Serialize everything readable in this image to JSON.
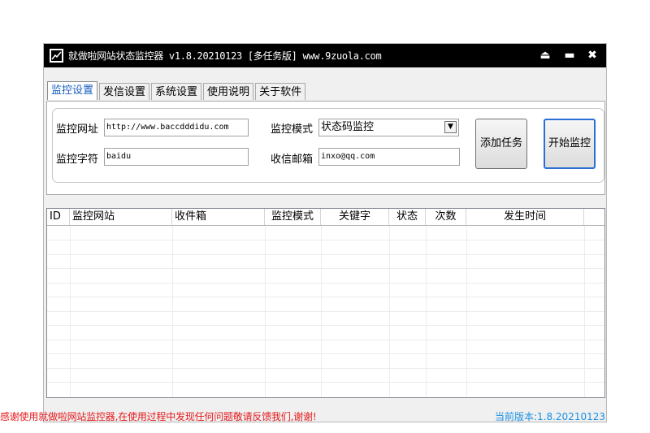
{
  "window": {
    "title": "就做啦网站状态监控器 v1.8.20210123 [多任务版] www.9zuola.com",
    "controls": {
      "pin": "⏏",
      "minimize": "▬",
      "close": "✖"
    }
  },
  "tabs": [
    {
      "label": "监控设置",
      "active": true
    },
    {
      "label": "发信设置",
      "active": false
    },
    {
      "label": "系统设置",
      "active": false
    },
    {
      "label": "使用说明",
      "active": false
    },
    {
      "label": "关于软件",
      "active": false
    }
  ],
  "form": {
    "url_label": "监控网址",
    "url_value": "http://www.baccdddidu.com",
    "keyword_label": "监控字符",
    "keyword_value": "baidu",
    "mode_label": "监控模式",
    "mode_value": "状态码监控",
    "email_label": "收信邮箱",
    "email_value": "inxo@qq.com",
    "add_task_button": "添加任务",
    "start_button": "开始监控"
  },
  "table": {
    "columns": [
      "ID",
      "监控网站",
      "收件箱",
      "监控模式",
      "关键字",
      "状态",
      "次数",
      "发生时间"
    ],
    "rows": []
  },
  "footer": {
    "message": "感谢使用就做啦网站监控器,在使用过程中发现任何问题敬请反馈我们,谢谢!",
    "version": "当前版本:1.8.20210123"
  },
  "colors": {
    "accent": "#2b6fd6",
    "footer_message": "#e5191b",
    "version": "#1a8fe3"
  },
  "icons": {
    "app": "app-chart-icon",
    "dropdown": "chevron-down-icon"
  }
}
